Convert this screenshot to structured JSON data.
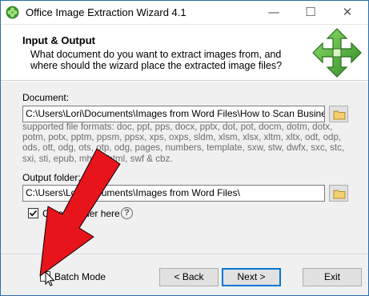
{
  "window": {
    "title": "Office Image Extraction Wizard 4.1",
    "controls": {
      "minimize": "—",
      "maximize": "☐",
      "close": "✕"
    }
  },
  "header": {
    "title": "Input & Output",
    "description": "What document do you want to extract images from, and where should the wizard place the extracted image files?"
  },
  "document": {
    "label": "Document:",
    "value": "C:\\Users\\Lori\\Documents\\Images from Word Files\\How to Scan Business Card",
    "supported_formats": "supported file formats: doc, ppt, pps, docx, pptx, dot, pot, docm, dotm, dotx, potm, potx, pptm, ppsm, ppsx, xps, oxps, sldm, xlsm, xlsx, xltm, xltx, odt, odp, ods, ott, odg, ots, otp, odg, pages, numbers, template, sxw, stw, dwfx, sxc, stc, sxi, sti, epub, mht, mhtml, swf & cbz."
  },
  "output": {
    "label": "Output folder:",
    "value": "C:\\Users\\Lori\\Documents\\Images from Word Files\\",
    "create_folder_label": "Create folder here",
    "create_folder_checked": true
  },
  "footer": {
    "batch_mode_label": "Batch Mode",
    "batch_mode_checked": false,
    "back_label": "< Back",
    "next_label": "Next >",
    "exit_label": "Exit"
  },
  "icons": {
    "app": "clover-icon",
    "header": "four-way-arrow-icon",
    "browse": "folder-icon",
    "help": "question-icon",
    "overlay": "red-arrow"
  },
  "colors": {
    "accent": "#0078d7",
    "overlay_arrow": "#e8141c",
    "header_graphic": "#4caf3c"
  }
}
